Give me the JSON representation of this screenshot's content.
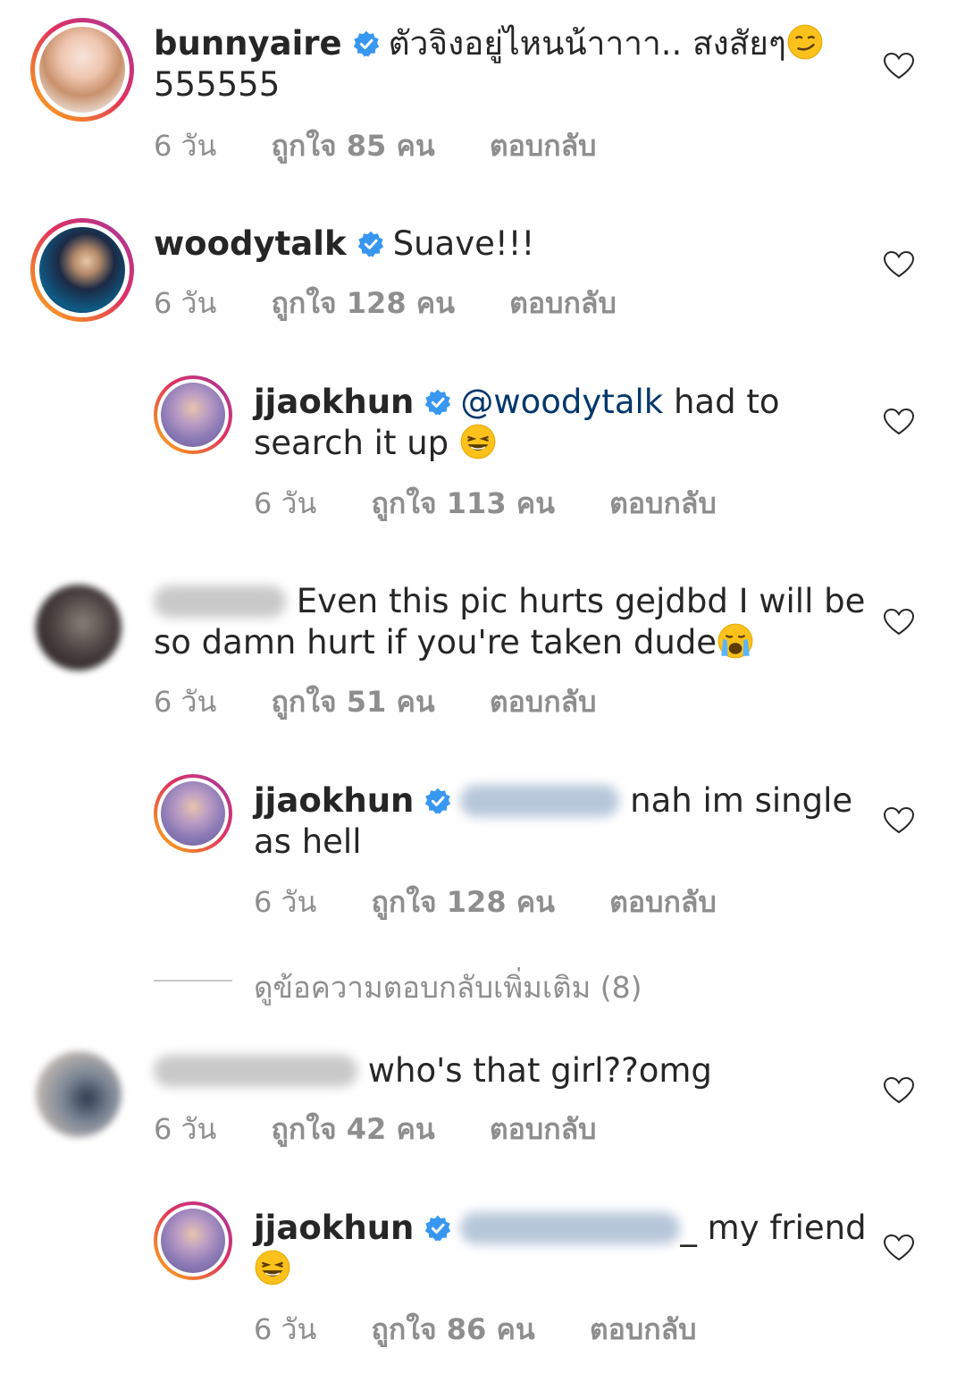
{
  "comments": [
    {
      "username": "bunnyaire",
      "text": "ตัวจิงอยู่ไหนน้าาาา.. สงสัยๆ",
      "text2": "555555",
      "time": "6 วัน",
      "likes": "ถูกใจ 85 คน",
      "reply": "ตอบกลับ"
    },
    {
      "username": "woodytalk",
      "text": "Suave!!!",
      "time": "6 วัน",
      "likes": "ถูกใจ 128 คน",
      "reply": "ตอบกลับ"
    },
    {
      "username": "jjaokhun",
      "mention": "@woodytalk",
      "text": "had to",
      "text2": "search it up",
      "time": "6 วัน",
      "likes": "ถูกใจ 113 คน",
      "reply": "ตอบกลับ"
    },
    {
      "text": "Even this pic hurts gejdbd I will be",
      "text2": "so damn hurt if you're taken dude",
      "time": "6 วัน",
      "likes": "ถูกใจ 51 คน",
      "reply": "ตอบกลับ"
    },
    {
      "username": "jjaokhun",
      "text": "nah im single",
      "text2": "as hell",
      "time": "6 วัน",
      "likes": "ถูกใจ 128 คน",
      "reply": "ตอบกลับ"
    },
    {
      "text": "who's that girl??omg",
      "time": "6 วัน",
      "likes": "ถูกใจ 42 คน",
      "reply": "ตอบกลับ"
    },
    {
      "username": "jjaokhun",
      "text": "_ my friend",
      "time": "6 วัน",
      "likes": "ถูกใจ 86 คน",
      "reply": "ตอบกลับ"
    }
  ],
  "view_more_replies": "ดูข้อความตอบกลับเพิ่มเติม (8)",
  "icons": {
    "verified": "verified-badge-icon",
    "heart": "heart-outline-icon"
  },
  "colors": {
    "verified": "#3897f0",
    "mention": "#00376b",
    "meta": "#8e8e8e"
  }
}
